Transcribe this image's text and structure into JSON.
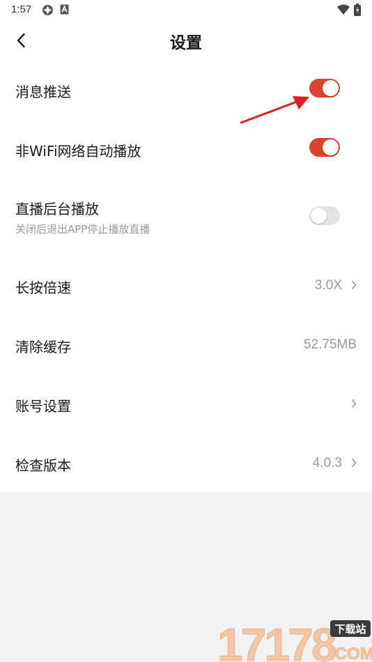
{
  "status_bar": {
    "time": "1:57"
  },
  "header": {
    "title": "设置"
  },
  "settings": {
    "push": {
      "label": "消息推送",
      "enabled": true
    },
    "wifi_autoplay": {
      "label": "非WiFi网络自动播放",
      "enabled": true
    },
    "bg_play": {
      "label": "直播后台播放",
      "sub": "关闭后退出APP停止播放直播",
      "enabled": false
    },
    "long_press_speed": {
      "label": "长按倍速",
      "value": "3.0X"
    },
    "clear_cache": {
      "label": "清除缓存",
      "value": "52.75MB"
    },
    "account": {
      "label": "账号设置"
    },
    "check_version": {
      "label": "检查版本",
      "value": "4.0.3"
    }
  },
  "colors": {
    "accent": "#d9432f",
    "toggle_off": "#e4e4e6",
    "page_background": "#f2f2f4",
    "annotation_arrow": "#e02020"
  },
  "watermark": {
    "brand": "17178",
    "tag": "下载站",
    "domain": ".COM"
  }
}
